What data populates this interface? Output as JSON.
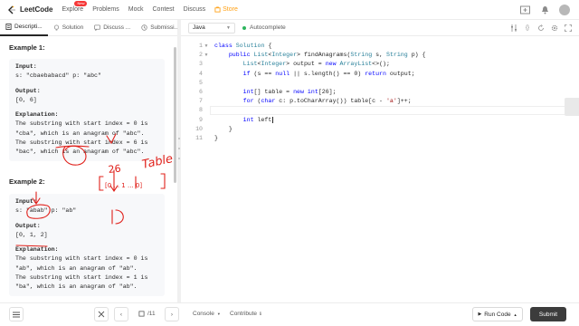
{
  "nav": {
    "logo_text": "LeetCode",
    "items": [
      "Explore",
      "Problems",
      "Mock",
      "Contest",
      "Discuss"
    ],
    "explore_badge": "New",
    "store_label": "Store"
  },
  "left_tabs": [
    {
      "label": "Descripti...",
      "icon": "description-icon"
    },
    {
      "label": "Solution",
      "icon": "solution-icon"
    },
    {
      "label": "Discuss ...",
      "icon": "discuss-icon"
    },
    {
      "label": "Submissi...",
      "icon": "submissions-icon"
    }
  ],
  "editor_bar": {
    "language": "Java",
    "autocomplete_label": "Autocomplete"
  },
  "examples": [
    {
      "title": "Example 1:",
      "input_label": "Input:",
      "input_value": "s: \"cbaebabacd\" p: \"abc\"",
      "output_label": "Output:",
      "output_value": "[0, 6]",
      "explanation_label": "Explanation:",
      "explanation_lines": [
        "The substring with start index = 0 is",
        "\"cba\", which is an anagram of \"abc\".",
        "The substring with start index = 6 is",
        "\"bac\", which is an anagram of \"abc\"."
      ]
    },
    {
      "title": "Example 2:",
      "input_label": "Input:",
      "input_value": "s: \"abab\" p: \"ab\"",
      "output_label": "Output:",
      "output_value": "[0, 1, 2]",
      "explanation_label": "Explanation:",
      "explanation_lines": [
        "The substring with start index = 0 is",
        "\"ab\", which is an anagram of \"ab\".",
        "The substring with start index = 1 is",
        "\"ba\", which is an anagram of \"ab\"."
      ]
    }
  ],
  "code": {
    "line_numbers": [
      "1",
      "2",
      "3",
      "4",
      "5",
      "6",
      "7",
      "8",
      "9",
      "10",
      "11"
    ]
  },
  "annotations": {
    "num_26": "26",
    "word_table": "Table",
    "bracket_contents": "[0 ... 1 ... 0]"
  },
  "bottom": {
    "problems_label": "Problems",
    "pick_one_label": "Pick One",
    "page_label": "/11",
    "console_label": "Console",
    "contribute_label": "Contribute",
    "run_label": "Run Code",
    "submit_label": "Submit"
  },
  "colors": {
    "accent": "#ffa116",
    "annotation_red": "#e0201a",
    "submit_bg": "#3c3c3c",
    "keyword_blue": "#0000ff"
  }
}
